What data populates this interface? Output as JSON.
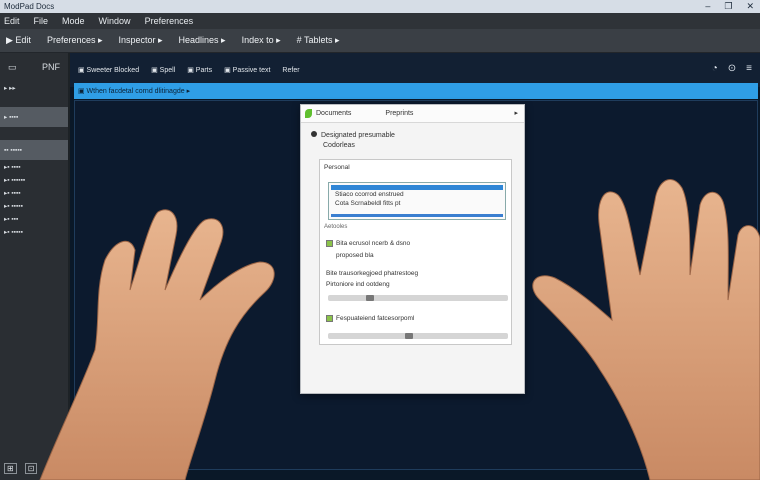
{
  "window": {
    "title": "ModPad Docs",
    "controls": [
      "–",
      "❐",
      "✕"
    ]
  },
  "menubar": {
    "items": [
      "Edit",
      "File",
      "Mode",
      "Window",
      "Preferences"
    ]
  },
  "toolbar": {
    "items": [
      "▶ Edit",
      "Preferences ▸",
      "Inspector ▸",
      "Headlines ▸",
      "Index to ▸",
      "# Tablets ▸"
    ]
  },
  "sidebar": {
    "header_left": "▭",
    "header_right": "PNF",
    "items": [
      {
        "label": "▸ ▸▸",
        "selected": false
      },
      {
        "label": "",
        "selected": false
      },
      {
        "label": "▸ ▪▪▪▪",
        "selected": true
      },
      {
        "label": "",
        "selected": false
      },
      {
        "label": "▪▪ ▪▪▪▪▪",
        "selected": true
      },
      {
        "label": "▸▪ ▪▪▪▪",
        "selected": false
      },
      {
        "label": "▸▪ ▪▪▪▪▪▪",
        "selected": false
      },
      {
        "label": "▸▪ ▪▪▪▪",
        "selected": false
      },
      {
        "label": "▸▪ ▪▪▪▪▪",
        "selected": false
      },
      {
        "label": "▸▪ ▪▪▪",
        "selected": false
      },
      {
        "label": "▸▪ ▪▪▪▪▪",
        "selected": false
      }
    ],
    "bottom": [
      "⊞",
      "⊡"
    ]
  },
  "main": {
    "toolbar_items": [
      "▣ Sweeter Blocked",
      "▣ Spell",
      "▣ Parts",
      "▣ Passive text",
      "Refer"
    ],
    "toolbar_right": [
      "◔",
      "⊙",
      "≡"
    ],
    "strip_text": "▣ Wthen facdetal cornd dlitinagde ▸"
  },
  "dialog": {
    "title_left": "Documents",
    "title_right": "Preprints",
    "close": "▸",
    "heading": "Designated presumable",
    "subheading": "Codorleas",
    "section_label": "Personal",
    "list_rows": [
      "Stiaco ccorrod enstrued",
      "Cota Scrnabeldl fitts pt"
    ],
    "sub_label": "Aetooles",
    "option1": "Bita ecrusol ncerb & dsno",
    "option1b": "proposed bla",
    "option2": "Bite trausorkegjoed phatrestoeg",
    "option2b": "Pirtoniore ind ootdeng",
    "option3": "Fespuateiend fatcesorpoml",
    "slider1": 0.22,
    "slider2": 0.45
  },
  "colors": {
    "accent": "#2f9ee6",
    "checkbox": "#8bc34a",
    "selection": "#2e86d6"
  }
}
